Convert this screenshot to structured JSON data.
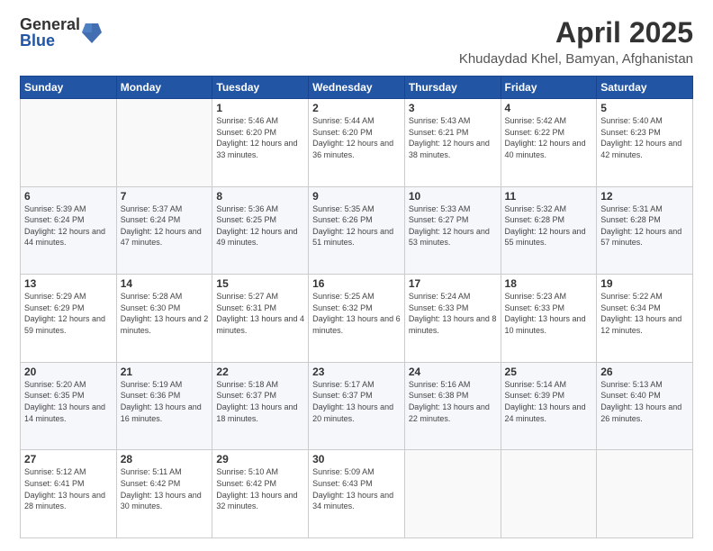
{
  "logo": {
    "general": "General",
    "blue": "Blue"
  },
  "header": {
    "month": "April 2025",
    "location": "Khudaydad Khel, Bamyan, Afghanistan"
  },
  "weekdays": [
    "Sunday",
    "Monday",
    "Tuesday",
    "Wednesday",
    "Thursday",
    "Friday",
    "Saturday"
  ],
  "weeks": [
    [
      {
        "day": "",
        "sunrise": "",
        "sunset": "",
        "daylight": ""
      },
      {
        "day": "",
        "sunrise": "",
        "sunset": "",
        "daylight": ""
      },
      {
        "day": "1",
        "sunrise": "Sunrise: 5:46 AM",
        "sunset": "Sunset: 6:20 PM",
        "daylight": "Daylight: 12 hours and 33 minutes."
      },
      {
        "day": "2",
        "sunrise": "Sunrise: 5:44 AM",
        "sunset": "Sunset: 6:20 PM",
        "daylight": "Daylight: 12 hours and 36 minutes."
      },
      {
        "day": "3",
        "sunrise": "Sunrise: 5:43 AM",
        "sunset": "Sunset: 6:21 PM",
        "daylight": "Daylight: 12 hours and 38 minutes."
      },
      {
        "day": "4",
        "sunrise": "Sunrise: 5:42 AM",
        "sunset": "Sunset: 6:22 PM",
        "daylight": "Daylight: 12 hours and 40 minutes."
      },
      {
        "day": "5",
        "sunrise": "Sunrise: 5:40 AM",
        "sunset": "Sunset: 6:23 PM",
        "daylight": "Daylight: 12 hours and 42 minutes."
      }
    ],
    [
      {
        "day": "6",
        "sunrise": "Sunrise: 5:39 AM",
        "sunset": "Sunset: 6:24 PM",
        "daylight": "Daylight: 12 hours and 44 minutes."
      },
      {
        "day": "7",
        "sunrise": "Sunrise: 5:37 AM",
        "sunset": "Sunset: 6:24 PM",
        "daylight": "Daylight: 12 hours and 47 minutes."
      },
      {
        "day": "8",
        "sunrise": "Sunrise: 5:36 AM",
        "sunset": "Sunset: 6:25 PM",
        "daylight": "Daylight: 12 hours and 49 minutes."
      },
      {
        "day": "9",
        "sunrise": "Sunrise: 5:35 AM",
        "sunset": "Sunset: 6:26 PM",
        "daylight": "Daylight: 12 hours and 51 minutes."
      },
      {
        "day": "10",
        "sunrise": "Sunrise: 5:33 AM",
        "sunset": "Sunset: 6:27 PM",
        "daylight": "Daylight: 12 hours and 53 minutes."
      },
      {
        "day": "11",
        "sunrise": "Sunrise: 5:32 AM",
        "sunset": "Sunset: 6:28 PM",
        "daylight": "Daylight: 12 hours and 55 minutes."
      },
      {
        "day": "12",
        "sunrise": "Sunrise: 5:31 AM",
        "sunset": "Sunset: 6:28 PM",
        "daylight": "Daylight: 12 hours and 57 minutes."
      }
    ],
    [
      {
        "day": "13",
        "sunrise": "Sunrise: 5:29 AM",
        "sunset": "Sunset: 6:29 PM",
        "daylight": "Daylight: 12 hours and 59 minutes."
      },
      {
        "day": "14",
        "sunrise": "Sunrise: 5:28 AM",
        "sunset": "Sunset: 6:30 PM",
        "daylight": "Daylight: 13 hours and 2 minutes."
      },
      {
        "day": "15",
        "sunrise": "Sunrise: 5:27 AM",
        "sunset": "Sunset: 6:31 PM",
        "daylight": "Daylight: 13 hours and 4 minutes."
      },
      {
        "day": "16",
        "sunrise": "Sunrise: 5:25 AM",
        "sunset": "Sunset: 6:32 PM",
        "daylight": "Daylight: 13 hours and 6 minutes."
      },
      {
        "day": "17",
        "sunrise": "Sunrise: 5:24 AM",
        "sunset": "Sunset: 6:33 PM",
        "daylight": "Daylight: 13 hours and 8 minutes."
      },
      {
        "day": "18",
        "sunrise": "Sunrise: 5:23 AM",
        "sunset": "Sunset: 6:33 PM",
        "daylight": "Daylight: 13 hours and 10 minutes."
      },
      {
        "day": "19",
        "sunrise": "Sunrise: 5:22 AM",
        "sunset": "Sunset: 6:34 PM",
        "daylight": "Daylight: 13 hours and 12 minutes."
      }
    ],
    [
      {
        "day": "20",
        "sunrise": "Sunrise: 5:20 AM",
        "sunset": "Sunset: 6:35 PM",
        "daylight": "Daylight: 13 hours and 14 minutes."
      },
      {
        "day": "21",
        "sunrise": "Sunrise: 5:19 AM",
        "sunset": "Sunset: 6:36 PM",
        "daylight": "Daylight: 13 hours and 16 minutes."
      },
      {
        "day": "22",
        "sunrise": "Sunrise: 5:18 AM",
        "sunset": "Sunset: 6:37 PM",
        "daylight": "Daylight: 13 hours and 18 minutes."
      },
      {
        "day": "23",
        "sunrise": "Sunrise: 5:17 AM",
        "sunset": "Sunset: 6:37 PM",
        "daylight": "Daylight: 13 hours and 20 minutes."
      },
      {
        "day": "24",
        "sunrise": "Sunrise: 5:16 AM",
        "sunset": "Sunset: 6:38 PM",
        "daylight": "Daylight: 13 hours and 22 minutes."
      },
      {
        "day": "25",
        "sunrise": "Sunrise: 5:14 AM",
        "sunset": "Sunset: 6:39 PM",
        "daylight": "Daylight: 13 hours and 24 minutes."
      },
      {
        "day": "26",
        "sunrise": "Sunrise: 5:13 AM",
        "sunset": "Sunset: 6:40 PM",
        "daylight": "Daylight: 13 hours and 26 minutes."
      }
    ],
    [
      {
        "day": "27",
        "sunrise": "Sunrise: 5:12 AM",
        "sunset": "Sunset: 6:41 PM",
        "daylight": "Daylight: 13 hours and 28 minutes."
      },
      {
        "day": "28",
        "sunrise": "Sunrise: 5:11 AM",
        "sunset": "Sunset: 6:42 PM",
        "daylight": "Daylight: 13 hours and 30 minutes."
      },
      {
        "day": "29",
        "sunrise": "Sunrise: 5:10 AM",
        "sunset": "Sunset: 6:42 PM",
        "daylight": "Daylight: 13 hours and 32 minutes."
      },
      {
        "day": "30",
        "sunrise": "Sunrise: 5:09 AM",
        "sunset": "Sunset: 6:43 PM",
        "daylight": "Daylight: 13 hours and 34 minutes."
      },
      {
        "day": "",
        "sunrise": "",
        "sunset": "",
        "daylight": ""
      },
      {
        "day": "",
        "sunrise": "",
        "sunset": "",
        "daylight": ""
      },
      {
        "day": "",
        "sunrise": "",
        "sunset": "",
        "daylight": ""
      }
    ]
  ]
}
